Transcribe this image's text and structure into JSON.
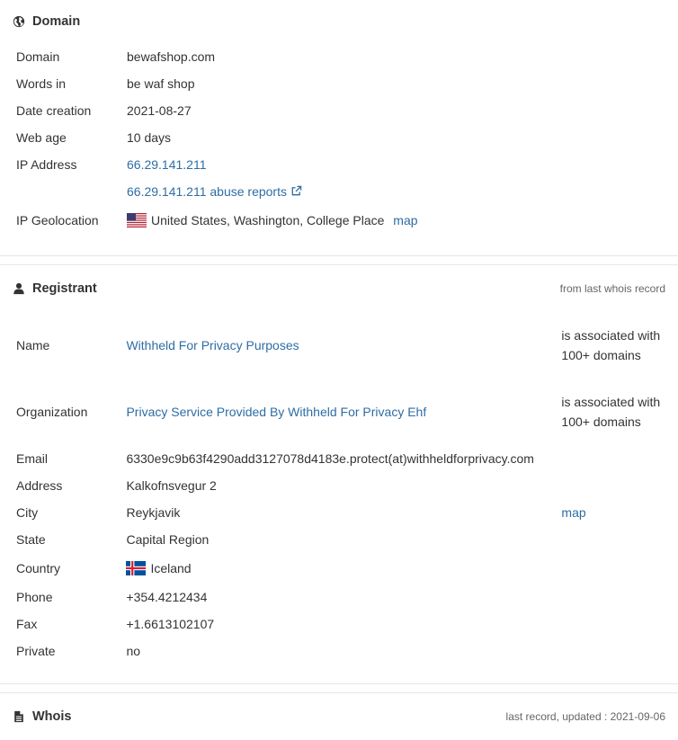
{
  "domain": {
    "title": "Domain",
    "rows": {
      "domain": {
        "label": "Domain",
        "value": "bewafshop.com"
      },
      "words": {
        "label": "Words in",
        "value": "be waf shop"
      },
      "date": {
        "label": "Date creation",
        "value": "2021-08-27"
      },
      "age": {
        "label": "Web age",
        "value": "10 days"
      },
      "ip": {
        "label": "IP Address",
        "value": "66.29.141.211",
        "abuse": "66.29.141.211 abuse reports"
      },
      "geo": {
        "label": "IP Geolocation",
        "value": "United States, Washington, College Place",
        "map": "map"
      }
    }
  },
  "registrant": {
    "title": "Registrant",
    "note": "from last whois record",
    "rows": {
      "name": {
        "label": "Name",
        "value": "Withheld For Privacy Purposes",
        "extra": "is associated with 100+ domains"
      },
      "org": {
        "label": "Organization",
        "value": "Privacy Service Provided By Withheld For Privacy Ehf",
        "extra": "is associated with 100+ domains"
      },
      "email": {
        "label": "Email",
        "value": "6330e9c9b63f4290add3127078d4183e.protect(at)withheldforprivacy.com"
      },
      "address": {
        "label": "Address",
        "value": "Kalkofnsvegur 2"
      },
      "city": {
        "label": "City",
        "value": "Reykjavik",
        "map": "map"
      },
      "state": {
        "label": "State",
        "value": "Capital Region"
      },
      "country": {
        "label": "Country",
        "value": "Iceland"
      },
      "phone": {
        "label": "Phone",
        "value": "+354.4212434"
      },
      "fax": {
        "label": "Fax",
        "value": "+1.6613102107"
      },
      "private": {
        "label": "Private",
        "value": "no"
      }
    }
  },
  "whois": {
    "title": "Whois",
    "note": "last record, updated : 2021-09-06"
  },
  "icons": {
    "domain": "globe-icon",
    "registrant": "user-icon",
    "whois": "document-icon",
    "external": "external-link-icon",
    "us": "us-flag-icon",
    "iceland": "iceland-flag-icon"
  },
  "colors": {
    "link": "#2e6da4",
    "text": "#333333",
    "muted": "#666666",
    "border": "#e6e6e6"
  }
}
